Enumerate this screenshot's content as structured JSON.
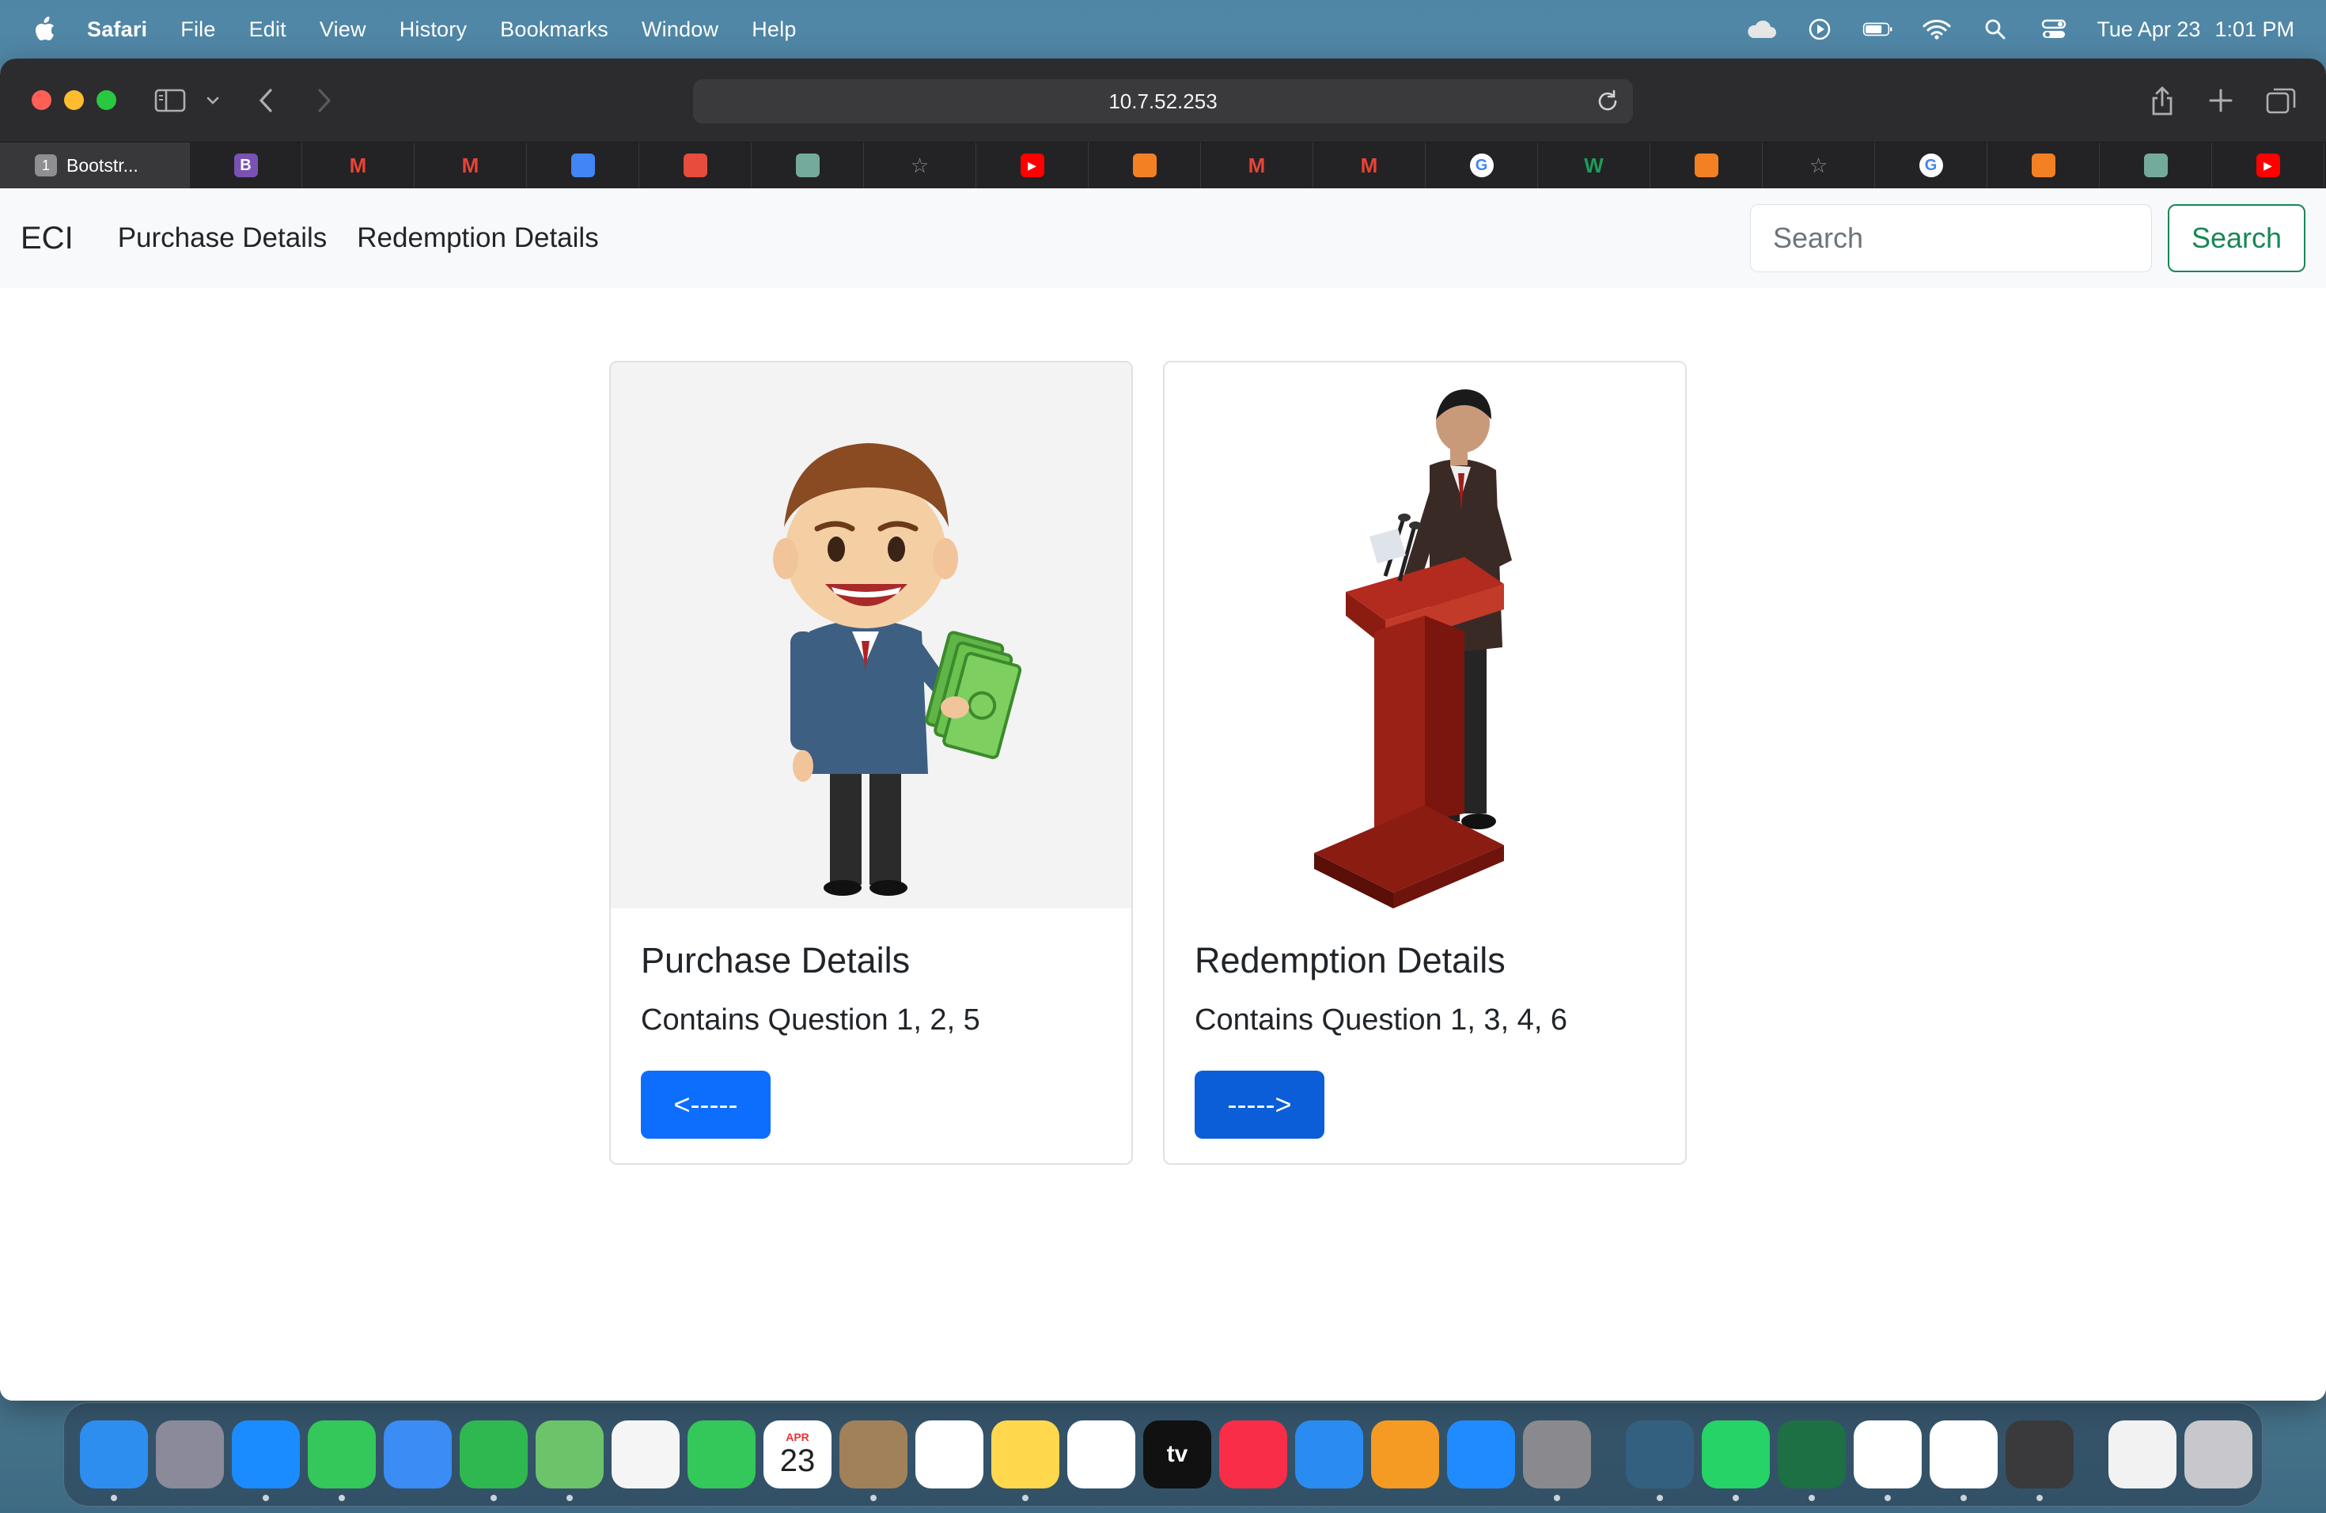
{
  "menubar": {
    "app_name": "Safari",
    "items": [
      "File",
      "Edit",
      "View",
      "History",
      "Bookmarks",
      "Window",
      "Help"
    ],
    "status_icons": [
      "icloud-icon",
      "play-icon",
      "battery-icon",
      "wifi-icon",
      "spotlight-icon",
      "control-center-icon"
    ],
    "date": "Tue Apr 23",
    "time": "1:01 PM"
  },
  "browser": {
    "url": "10.7.52.253",
    "active_tab": {
      "number": "1",
      "title": "Bootstr..."
    },
    "pinned_tabs": [
      {
        "icon": "bootstrap-icon",
        "label": "B",
        "color": "#7952b3"
      },
      {
        "icon": "gmail-icon",
        "label": "M",
        "color": "#ea4335"
      },
      {
        "icon": "gmail-icon",
        "label": "M",
        "color": "#ea4335"
      },
      {
        "icon": "contacts-icon",
        "label": "",
        "color": "#4285f4"
      },
      {
        "icon": "cube-icon",
        "label": "",
        "color": "#e74c3c"
      },
      {
        "icon": "chatgpt-icon",
        "label": "",
        "color": "#74aa9c"
      },
      {
        "icon": "star-icon",
        "label": "☆",
        "color": "#8e8e93"
      },
      {
        "icon": "youtube-icon",
        "label": "▶",
        "color": "#ff0000"
      },
      {
        "icon": "stackoverflow-icon",
        "label": "",
        "color": "#f48024"
      },
      {
        "icon": "gmail-icon",
        "label": "M",
        "color": "#ea4335"
      },
      {
        "icon": "gmail-icon",
        "label": "M",
        "color": "#ea4335"
      },
      {
        "icon": "google-icon",
        "label": "G",
        "color": "#4285f4"
      },
      {
        "icon": "w-icon",
        "label": "W",
        "color": "#1e9b5a"
      },
      {
        "icon": "stackoverflow-icon",
        "label": "",
        "color": "#f48024"
      },
      {
        "icon": "star-icon",
        "label": "☆",
        "color": "#8e8e93"
      },
      {
        "icon": "google-icon",
        "label": "G",
        "color": "#4285f4"
      },
      {
        "icon": "stackoverflow-icon",
        "label": "",
        "color": "#f48024"
      },
      {
        "icon": "chatgpt-icon",
        "label": "",
        "color": "#74aa9c"
      },
      {
        "icon": "youtube-icon",
        "label": "▶",
        "color": "#ff0000"
      }
    ]
  },
  "navbar": {
    "brand": "ECI",
    "links": [
      "Purchase Details",
      "Redemption Details"
    ],
    "search_placeholder": "Search",
    "search_button": "Search"
  },
  "cards": [
    {
      "title": "Purchase Details",
      "text": "Contains Question 1, 2, 5",
      "button": "<-----"
    },
    {
      "title": "Redemption Details",
      "text": "Contains Question 1, 3, 4, 6",
      "button": "----->"
    }
  ],
  "dock": {
    "apps": [
      {
        "name": "finder",
        "color": "#2d8ef0"
      },
      {
        "name": "launchpad",
        "color": "#8a8a9a"
      },
      {
        "name": "safari",
        "color": "#1a8cff"
      },
      {
        "name": "messages",
        "color": "#34c759"
      },
      {
        "name": "mail",
        "color": "#3b8cf5"
      },
      {
        "name": "numbers",
        "color": "#2fb84f"
      },
      {
        "name": "maps",
        "color": "#6cc36a"
      },
      {
        "name": "photos",
        "color": "#f5f5f5"
      },
      {
        "name": "facetime",
        "color": "#34c759"
      },
      {
        "name": "calendar",
        "color": "#ffffff",
        "month": "APR",
        "day": "23"
      },
      {
        "name": "contacts",
        "color": "#a0815a"
      },
      {
        "name": "reminders",
        "color": "#ffffff"
      },
      {
        "name": "notes",
        "color": "#ffd84d"
      },
      {
        "name": "freeform",
        "color": "#ffffff"
      },
      {
        "name": "apple-tv",
        "color": "#111111",
        "label": "tv"
      },
      {
        "name": "music",
        "color": "#fa2d48"
      },
      {
        "name": "keynote",
        "color": "#2a8cf0"
      },
      {
        "name": "pages",
        "color": "#f59a23"
      },
      {
        "name": "app-store",
        "color": "#1f8bff"
      },
      {
        "name": "system-settings",
        "color": "#8a8a8e"
      },
      {
        "name": "mysql-workbench",
        "color": "#34607f"
      },
      {
        "name": "whatsapp",
        "color": "#25d366"
      },
      {
        "name": "excel",
        "color": "#1d7044"
      },
      {
        "name": "chrome",
        "color": "#ffffff"
      },
      {
        "name": "vscode",
        "color": "#ffffff"
      },
      {
        "name": "calculator",
        "color": "#3a3a3c"
      },
      {
        "name": "documents",
        "color": "#f2f2f2"
      },
      {
        "name": "trash",
        "color": "#c7c7cc"
      }
    ]
  }
}
